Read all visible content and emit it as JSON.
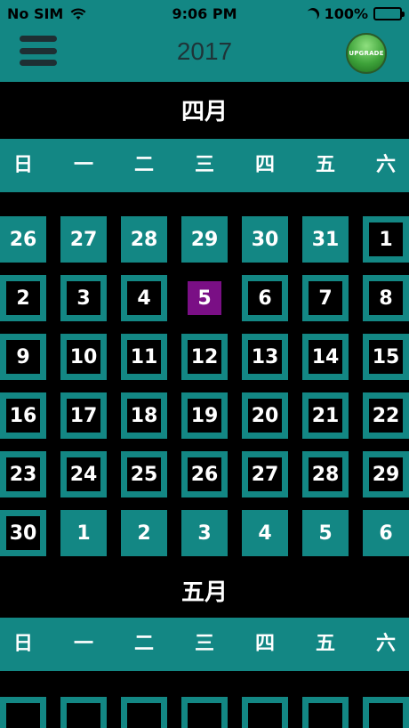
{
  "status_bar": {
    "carrier": "No SIM",
    "time": "9:06 PM",
    "battery": "100%"
  },
  "header": {
    "year": "2017",
    "upgrade_label": "UPGRADE"
  },
  "weekdays": [
    "日",
    "一",
    "二",
    "三",
    "四",
    "五",
    "六"
  ],
  "months": [
    {
      "title": "四月",
      "weeks": [
        [
          {
            "d": "26",
            "cur": false
          },
          {
            "d": "27",
            "cur": false
          },
          {
            "d": "28",
            "cur": false
          },
          {
            "d": "29",
            "cur": false
          },
          {
            "d": "30",
            "cur": false
          },
          {
            "d": "31",
            "cur": false
          },
          {
            "d": "1",
            "cur": true
          }
        ],
        [
          {
            "d": "2",
            "cur": true
          },
          {
            "d": "3",
            "cur": true
          },
          {
            "d": "4",
            "cur": true
          },
          {
            "d": "5",
            "cur": true,
            "today": true
          },
          {
            "d": "6",
            "cur": true
          },
          {
            "d": "7",
            "cur": true
          },
          {
            "d": "8",
            "cur": true
          }
        ],
        [
          {
            "d": "9",
            "cur": true
          },
          {
            "d": "10",
            "cur": true
          },
          {
            "d": "11",
            "cur": true
          },
          {
            "d": "12",
            "cur": true
          },
          {
            "d": "13",
            "cur": true
          },
          {
            "d": "14",
            "cur": true
          },
          {
            "d": "15",
            "cur": true
          }
        ],
        [
          {
            "d": "16",
            "cur": true
          },
          {
            "d": "17",
            "cur": true
          },
          {
            "d": "18",
            "cur": true
          },
          {
            "d": "19",
            "cur": true
          },
          {
            "d": "20",
            "cur": true
          },
          {
            "d": "21",
            "cur": true
          },
          {
            "d": "22",
            "cur": true
          }
        ],
        [
          {
            "d": "23",
            "cur": true
          },
          {
            "d": "24",
            "cur": true
          },
          {
            "d": "25",
            "cur": true
          },
          {
            "d": "26",
            "cur": true
          },
          {
            "d": "27",
            "cur": true
          },
          {
            "d": "28",
            "cur": true
          },
          {
            "d": "29",
            "cur": true
          }
        ],
        [
          {
            "d": "30",
            "cur": true
          },
          {
            "d": "1",
            "cur": false
          },
          {
            "d": "2",
            "cur": false
          },
          {
            "d": "3",
            "cur": false
          },
          {
            "d": "4",
            "cur": false
          },
          {
            "d": "5",
            "cur": false
          },
          {
            "d": "6",
            "cur": false
          }
        ]
      ]
    },
    {
      "title": "五月"
    }
  ],
  "colors": {
    "teal": "#138784",
    "today": "#7a0f85",
    "background": "#000000"
  },
  "icons": {
    "menu": "hamburger-menu-icon",
    "wifi": "wifi-icon",
    "moon": "moon-icon",
    "battery": "battery-icon"
  }
}
